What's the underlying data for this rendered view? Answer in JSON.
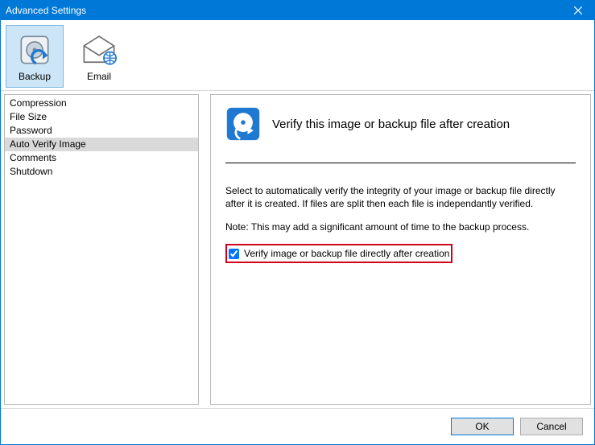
{
  "window": {
    "title": "Advanced Settings"
  },
  "toolbar": {
    "backup": "Backup",
    "email": "Email"
  },
  "sidebar": {
    "items": [
      {
        "label": "Compression"
      },
      {
        "label": "File Size"
      },
      {
        "label": "Password"
      },
      {
        "label": "Auto Verify Image"
      },
      {
        "label": "Comments"
      },
      {
        "label": "Shutdown"
      }
    ],
    "selected_index": 3
  },
  "content": {
    "title": "Verify this image or backup file after creation",
    "description": "Select to automatically verify the integrity of your image or backup file directly after it is created. If files are split then each file is independantly verified.",
    "note": "Note: This may add a significant amount of time to the backup process.",
    "checkbox_label": "Verify image or backup file directly after creation",
    "checkbox_checked": true
  },
  "footer": {
    "ok": "OK",
    "cancel": "Cancel"
  }
}
